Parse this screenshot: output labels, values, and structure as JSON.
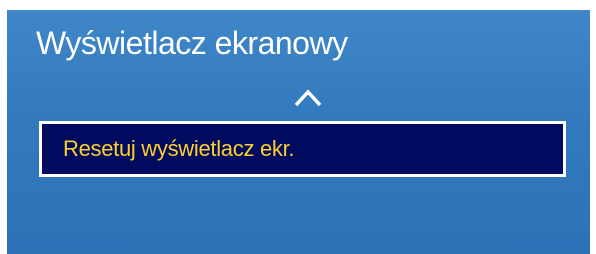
{
  "screen": {
    "title": "Wyświetlacz ekranowy"
  },
  "navigation": {
    "scroll_up_icon": "chevron-up-icon"
  },
  "menu": {
    "items": [
      {
        "label": "Resetuj wyświetlacz ekr.",
        "selected": true
      }
    ]
  },
  "colors": {
    "panel_background": "#3279bd",
    "selection_background": "#000a5e",
    "selection_border": "#ffffff",
    "selected_text": "#ffcf2e",
    "title_text": "#ffffff"
  }
}
